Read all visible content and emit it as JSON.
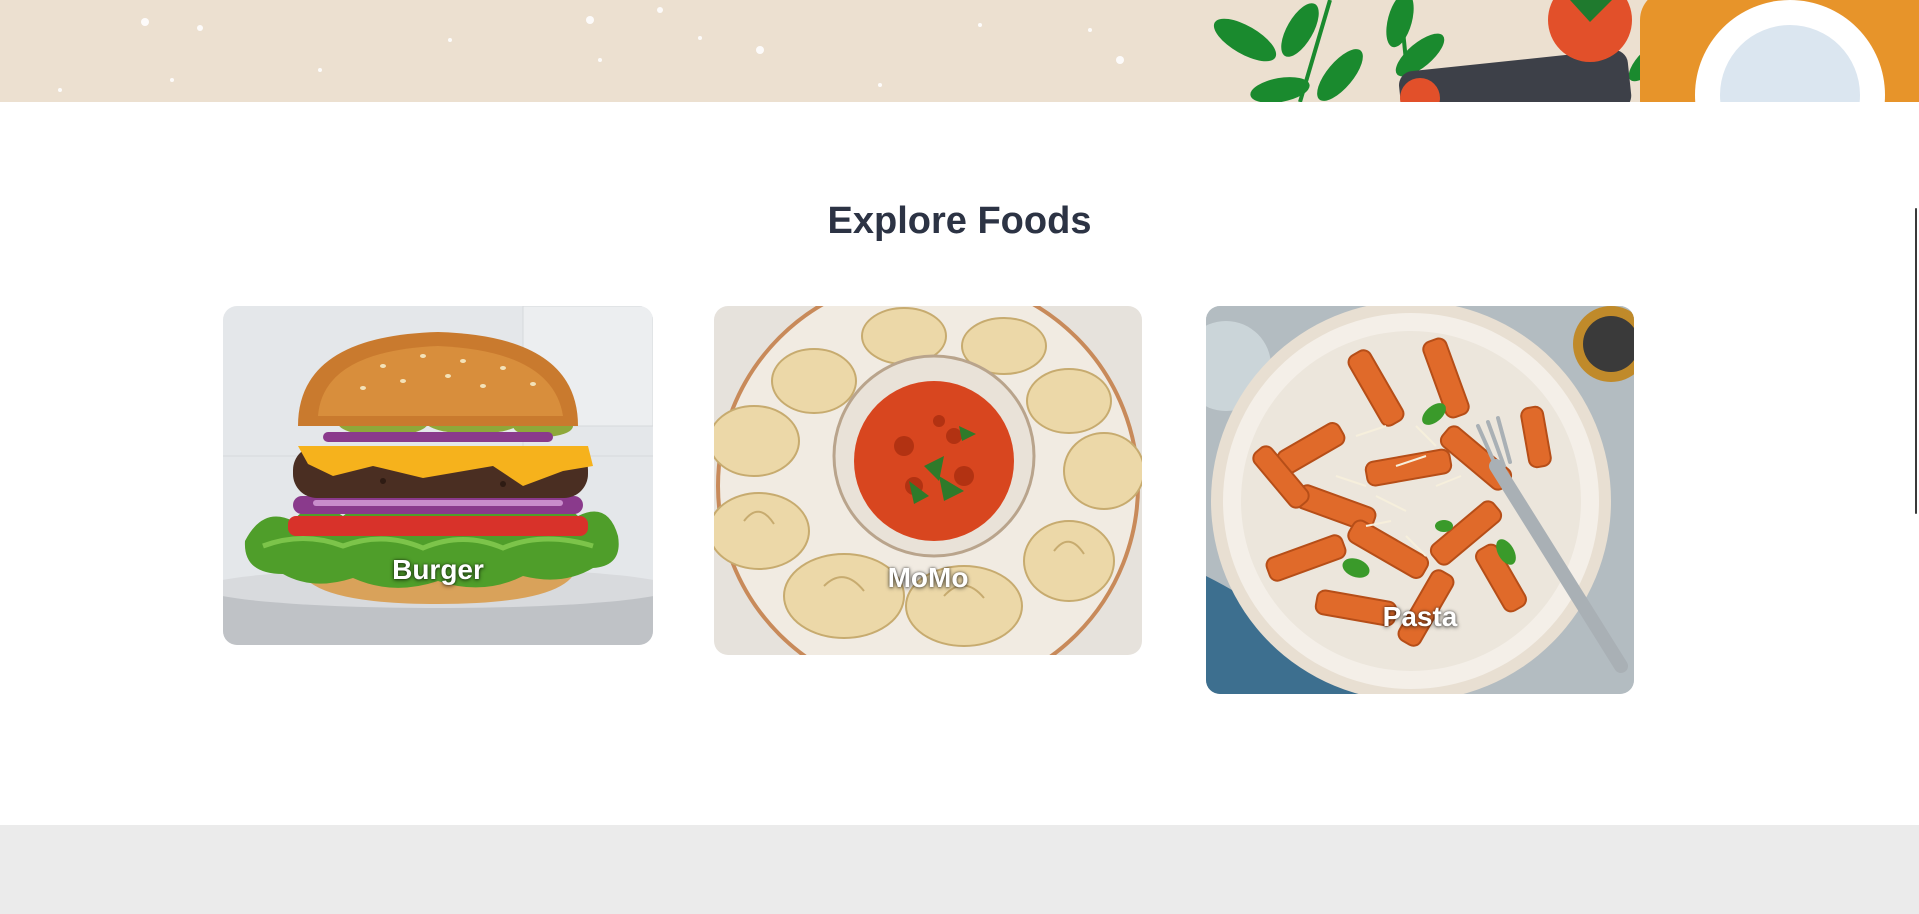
{
  "section": {
    "title": "Explore Foods"
  },
  "foods": [
    {
      "name": "Burger",
      "image_icon": "burger-photo"
    },
    {
      "name": "MoMo",
      "image_icon": "momo-photo"
    },
    {
      "name": "Pasta",
      "image_icon": "pasta-photo"
    }
  ],
  "colors": {
    "banner_background": "#ece0d0",
    "title_text": "#2c3344",
    "footer_background": "#ebebeb",
    "label_text": "#ffffff"
  }
}
